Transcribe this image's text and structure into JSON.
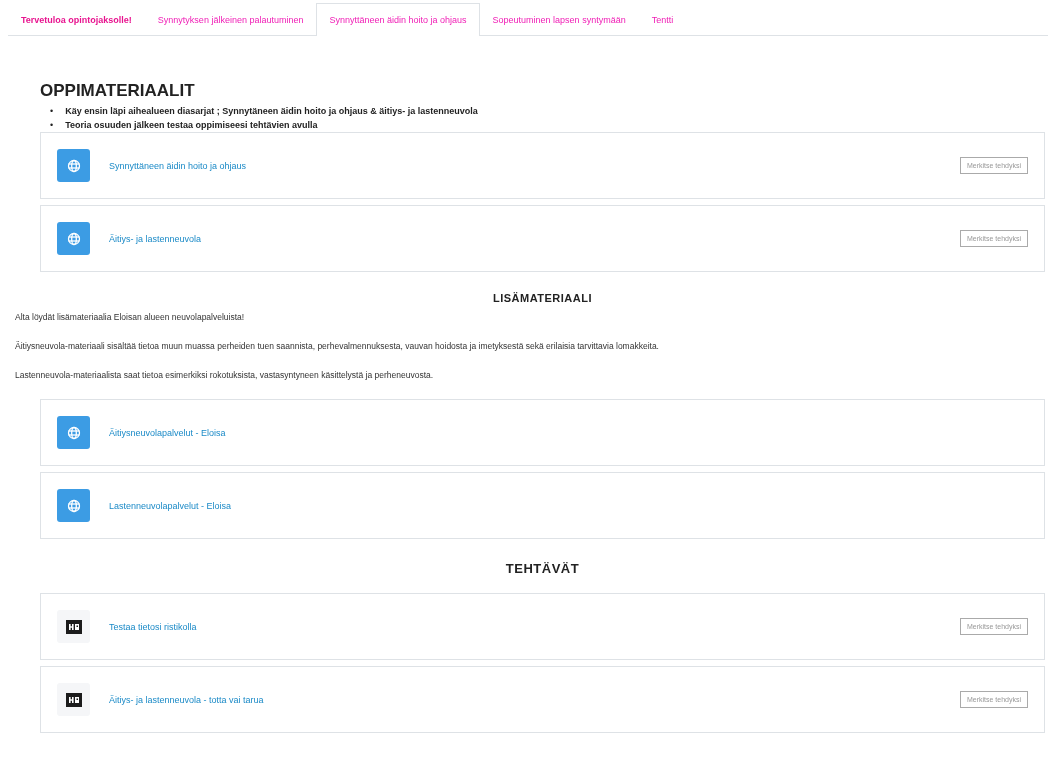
{
  "tabs": [
    {
      "label": "Tervetuloa opintojaksolle!",
      "selected": false,
      "bold": true
    },
    {
      "label": "Synnytyksen jälkeinen palautuminen",
      "selected": false,
      "bold": false
    },
    {
      "label": "Synnyttäneen äidin hoito ja ohjaus",
      "selected": true,
      "bold": false
    },
    {
      "label": "Sopeutuminen lapsen syntymään",
      "selected": false,
      "bold": false
    },
    {
      "label": "Tentti",
      "selected": false,
      "bold": false
    }
  ],
  "sections": [
    {
      "title": "OPPIMATERIAALIT",
      "kind": "main",
      "bullets": [
        {
          "marker": "•",
          "text": "Käy ensin läpi aihealueen diasarjat ; Synnytäneen äidin hoito ja ohjaus & äitiys- ja lastenneuvola"
        },
        {
          "marker": "•",
          "text": "Teoria osuuden jälkeen testaa oppimiseesi tehtävien avulla"
        }
      ],
      "activities": [
        {
          "kind": "url",
          "title": "Synnyttäneen äidin hoito ja ohjaus",
          "button": "Merkitse tehdyksi"
        },
        {
          "kind": "url",
          "title": "Äitiys- ja lastenneuvola",
          "button": "Merkitse tehdyksi"
        }
      ]
    },
    {
      "title": "LISÄMATERIAALI",
      "kind": "sub",
      "paragraphs": [
        "Alta löydät lisämateriaalia Eloisan alueen neuvolapalveluista!",
        "Äitiysneuvola-materiaali sisältää tietoa muun muassa perheiden tuen saannista, perhevalmennuksesta, vauvan hoidosta ja imetyksestä sekä erilaisia tarvittavia lomakkeita.",
        "Lastenneuvola-materiaalista saat tietoa esimerkiksi rokotuksista, vastasyntyneen käsittelystä ja perheneuvosta."
      ],
      "activities": [
        {
          "kind": "url",
          "title": "Äitiysneuvolapalvelut - Eloisa"
        },
        {
          "kind": "url",
          "title": "Lastenneuvolapalvelut - Eloisa"
        }
      ]
    },
    {
      "title": "TEHTÄVÄT",
      "kind": "sub",
      "activities": [
        {
          "kind": "h5p",
          "title": "Testaa tietosi ristikolla",
          "button": "Merkitse tehdyksi"
        },
        {
          "kind": "h5p",
          "title": "Äitiys- ja lastenneuvola - totta vai tarua",
          "button": "Merkitse tehdyksi"
        }
      ]
    }
  ]
}
